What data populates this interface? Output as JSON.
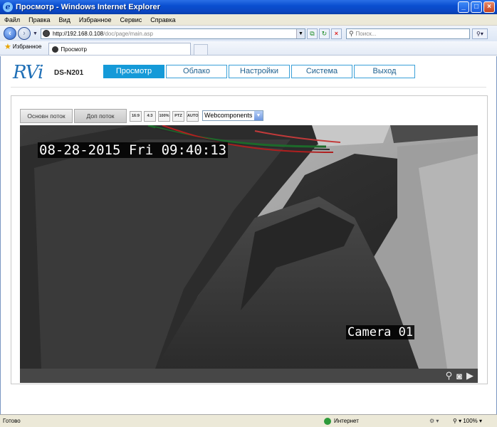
{
  "window": {
    "title": "Просмотр - Windows Internet Explorer",
    "app_icon": "e",
    "buttons": {
      "minimize": "_",
      "maximize": "□",
      "close": "×"
    }
  },
  "menubar": {
    "items": [
      "Файл",
      "Правка",
      "Вид",
      "Избранное",
      "Сервис",
      "Справка"
    ]
  },
  "browser": {
    "address_host": "http://192.168.0.108",
    "address_path": "/doc/page/main.asp",
    "search_placeholder": "Поиск...",
    "favorites_label": "Избранное",
    "tab_label": "Просмотр"
  },
  "app": {
    "logo": "RVi",
    "model": "DS-N201",
    "nav": [
      {
        "label": "Просмотр",
        "active": true
      },
      {
        "label": "Облако",
        "active": false
      },
      {
        "label": "Настройки",
        "active": false
      },
      {
        "label": "Система",
        "active": false
      },
      {
        "label": "Выход",
        "active": false
      }
    ]
  },
  "live": {
    "stream_buttons": [
      "Основн поток",
      "Доп поток"
    ],
    "ratio_buttons": [
      "16:9",
      "4:3",
      "100%",
      "PTZ",
      "AUTO"
    ],
    "plugin_select": "Webcomponents",
    "osd_datetime": "08-28-2015 Fri 09:40:13",
    "osd_camera": "Camera 01",
    "video_toolbar_icons": [
      "zoom-icon",
      "snapshot-icon",
      "record-icon"
    ]
  },
  "status": {
    "ready": "Готово",
    "zone": "Интернет",
    "zoom": "100%"
  },
  "colors": {
    "accent": "#159ad8",
    "logo": "#1f6fb6",
    "titlebar": "#0a4fd0"
  }
}
